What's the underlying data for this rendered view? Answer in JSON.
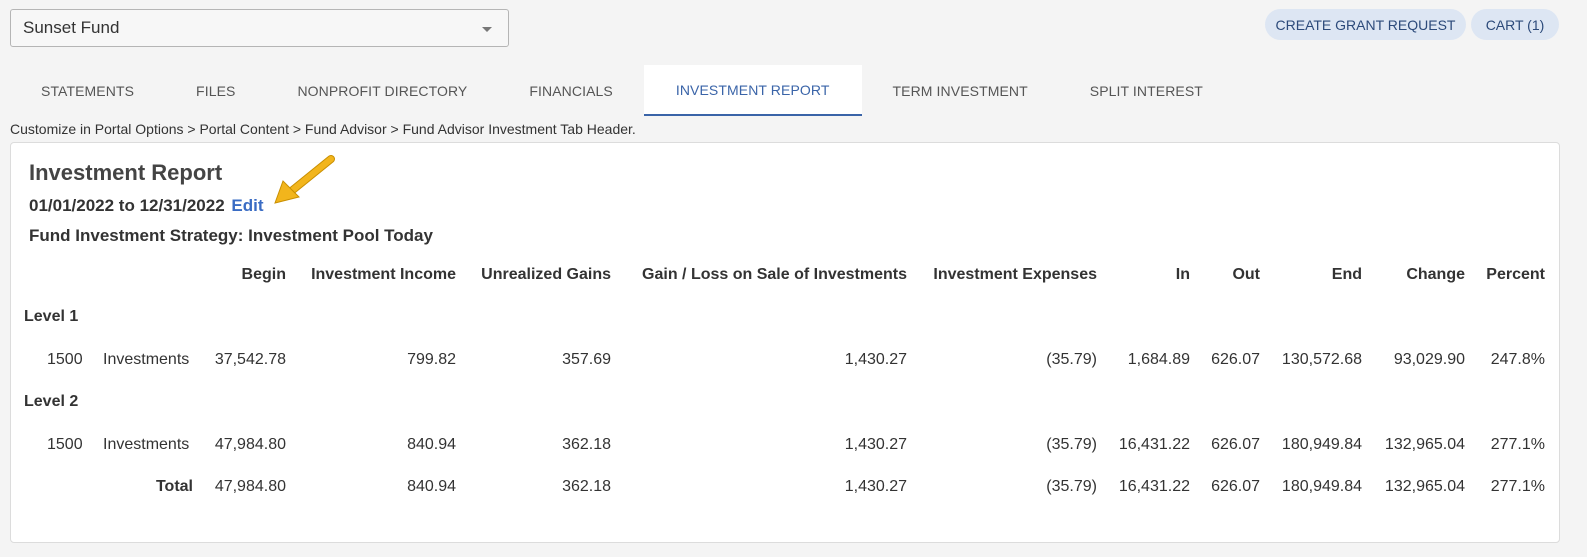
{
  "fund_selector": {
    "value": "Sunset Fund"
  },
  "buttons": {
    "create_grant": "CREATE GRANT REQUEST",
    "cart": "CART (1)"
  },
  "tabs": [
    {
      "label": "STATEMENTS",
      "active": false
    },
    {
      "label": "FILES",
      "active": false
    },
    {
      "label": "NONPROFIT DIRECTORY",
      "active": false
    },
    {
      "label": "FINANCIALS",
      "active": false
    },
    {
      "label": "INVESTMENT REPORT",
      "active": true
    },
    {
      "label": "TERM INVESTMENT",
      "active": false
    },
    {
      "label": "SPLIT INTEREST",
      "active": false
    }
  ],
  "breadcrumb": "Customize in Portal Options > Portal Content > Fund Advisor > Fund Advisor Investment Tab Header.",
  "report": {
    "title": "Investment Report",
    "date_range": "01/01/2022 to 12/31/2022",
    "edit_label": "Edit",
    "strategy": "Fund Investment Strategy: Investment Pool Today"
  },
  "table": {
    "headers": [
      "Begin",
      "Investment Income",
      "Unrealized Gains",
      "Gain / Loss on Sale of Investments",
      "Investment Expenses",
      "In",
      "Out",
      "End",
      "Change",
      "Percent"
    ],
    "groups": [
      {
        "label": "Level 1",
        "rows": [
          {
            "code": "1500",
            "name": "Investments",
            "values": [
              "37,542.78",
              "799.82",
              "357.69",
              "1,430.27",
              "(35.79)",
              "1,684.89",
              "626.07",
              "130,572.68",
              "93,029.90",
              "247.8%"
            ]
          }
        ]
      },
      {
        "label": "Level 2",
        "rows": [
          {
            "code": "1500",
            "name": "Investments",
            "values": [
              "47,984.80",
              "840.94",
              "362.18",
              "1,430.27",
              "(35.79)",
              "16,431.22",
              "626.07",
              "180,949.84",
              "132,965.04",
              "277.1%"
            ]
          }
        ]
      }
    ],
    "total": {
      "label": "Total",
      "values": [
        "47,984.80",
        "840.94",
        "362.18",
        "1,430.27",
        "(35.79)",
        "16,431.22",
        "626.07",
        "180,949.84",
        "132,965.04",
        "277.1%"
      ]
    }
  },
  "colors": {
    "accent": "#3a64a8",
    "link": "#3a6cc4",
    "button_bg": "#dde6f3",
    "annotation_arrow": "#f2b51c"
  },
  "icons": {
    "dropdown": "chevron-down-icon",
    "annotation": "arrow-pointer-icon"
  }
}
